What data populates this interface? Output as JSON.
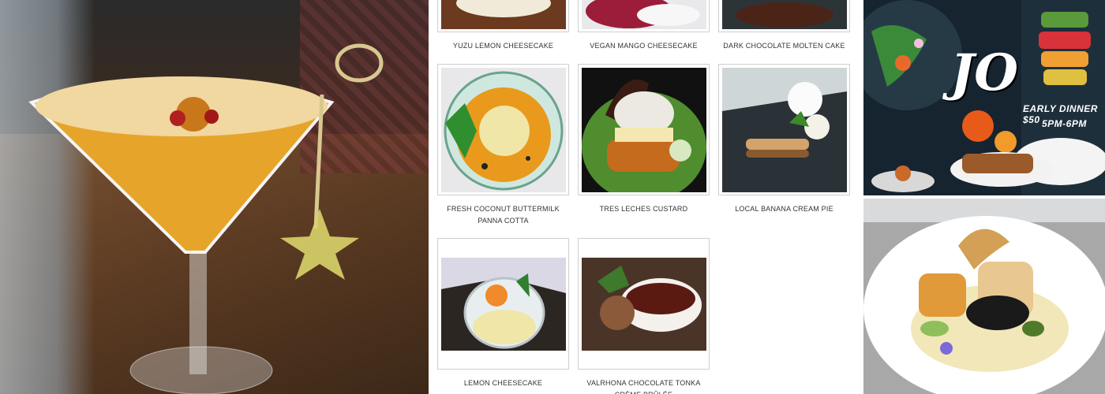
{
  "desserts": {
    "row1": [
      {
        "caption": "YUZU LEMON CHEESECAKE"
      },
      {
        "caption": "VEGAN MANGO CHEESECAKE"
      },
      {
        "caption": "DARK CHOCOLATE MOLTEN CAKE"
      }
    ],
    "row2": [
      {
        "caption": "FRESH COCONUT BUTTERMILK PANNA COTTA"
      },
      {
        "caption": "TRES LECHES CUSTARD"
      },
      {
        "caption": "LOCAL BANANA CREAM PIE"
      }
    ],
    "row3": [
      {
        "caption": "LEMON CHEESECAKE"
      },
      {
        "caption": "VALRHONA CHOCOLATE TONKA CRÈME BRÛLÉE"
      }
    ]
  },
  "promo": {
    "logo": "JO",
    "line1": "EARLY DINNER $50",
    "line2": "5PM-6PM"
  }
}
